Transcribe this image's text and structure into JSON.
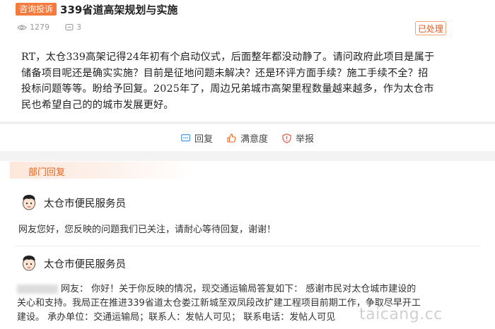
{
  "header": {
    "tag": "咨询投诉",
    "title": "339省道高架规划与实施",
    "views": "1279",
    "comments": "3",
    "status": "已处理",
    "accent": "#f57a3d"
  },
  "post": {
    "lines": [
      "RT，太仓339高架记得24年初有个启动仪式，后面整年都没动静了。请问政府此项目是属于",
      "储备项目呢还是确实实施？目前是征地问题未解决？还是环评方面手续？施工手续不全？招",
      "投标问题等等。盼给予回复。2025年了，周边兄弟城市高架里程数量越来越多，作为太仓市",
      "民也希望自己的的城市发展更好。"
    ]
  },
  "actions": {
    "reply": "回复",
    "satisfaction": "满意度",
    "report": "举报"
  },
  "department": {
    "tab": "部门回复"
  },
  "replies": [
    {
      "author": "太仓市便民服务员",
      "lines": [
        "网友您好，您反映的问题我们已关注，请耐心等待回复，谢谢！"
      ]
    },
    {
      "author": "太仓市便民服务员",
      "lines": [
        "网友：  你好！关于你反映的情况，现交通运输局答复如下：  感谢市民对太仓城市建设的",
        "关心和支持。我局正在推进339省道太仓娄江新城至双凤段改扩建工程项目前期工作，争取尽早开工",
        "建设。  承办单位：交通运输局；联系人：发帖人可见；  联系电话：发帖人可见"
      ]
    }
  ],
  "watermark": "taicang.cc"
}
